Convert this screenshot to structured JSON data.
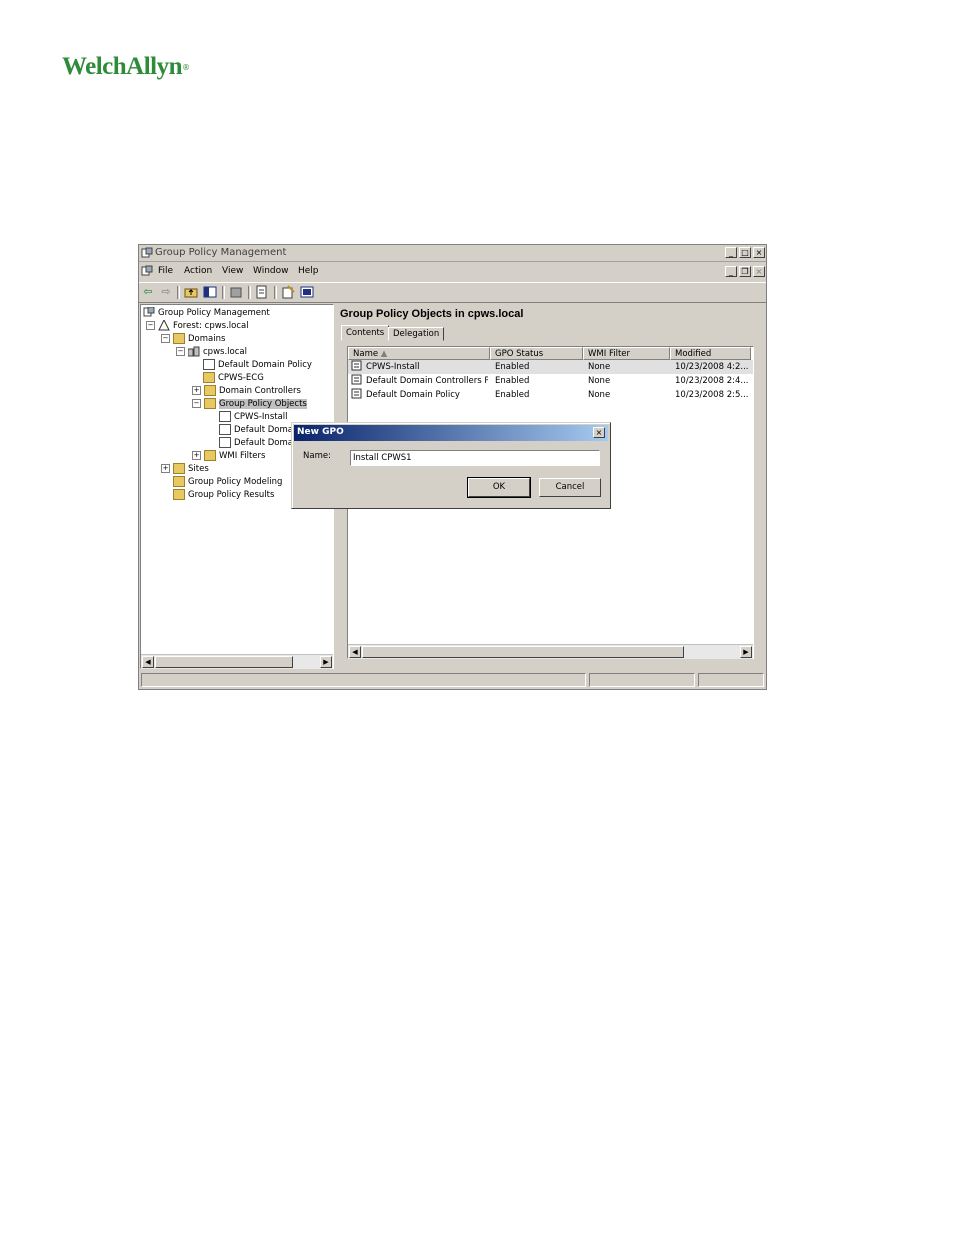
{
  "logo": {
    "text": "WelchAllyn",
    "reg": "®"
  },
  "window": {
    "title": "Group Policy Management"
  },
  "menu": [
    "File",
    "Action",
    "View",
    "Window",
    "Help"
  ],
  "toolbar": {
    "icons": [
      "back-arrow-icon",
      "forward-arrow-icon",
      "up-folder-icon",
      "show-hide-tree-icon",
      "delete-icon",
      "properties-icon",
      "export-list-icon",
      "help-icon"
    ]
  },
  "tree": {
    "root": "Group Policy Management",
    "forest": "Forest: cpws.local",
    "domains": "Domains",
    "domain": "cpws.local",
    "items": [
      "Default Domain Policy",
      "CPWS-ECG",
      "Domain Controllers",
      "Group Policy Objects"
    ],
    "gpos": [
      "CPWS-Install",
      "Default Domai",
      "Default Domai"
    ],
    "wmi": "WMI Filters",
    "sites": "Sites",
    "modeling": "Group Policy Modeling",
    "results": "Group Policy Results"
  },
  "pane": {
    "title": "Group Policy Objects in cpws.local",
    "tabs": [
      "Contents",
      "Delegation"
    ],
    "columns": [
      "Name",
      "GPO Status",
      "WMI Filter",
      "Modified"
    ],
    "rows": [
      {
        "name": "CPWS-Install",
        "status": "Enabled",
        "wmi": "None",
        "modified": "10/23/2008 4:2..."
      },
      {
        "name": "Default Domain Controllers P...",
        "status": "Enabled",
        "wmi": "None",
        "modified": "10/23/2008 2:4..."
      },
      {
        "name": "Default Domain Policy",
        "status": "Enabled",
        "wmi": "None",
        "modified": "10/23/2008 2:5..."
      }
    ]
  },
  "dialog": {
    "title": "New GPO",
    "name_label": "Name:",
    "name_value": "Install CPWS1",
    "ok": "OK",
    "cancel": "Cancel"
  }
}
